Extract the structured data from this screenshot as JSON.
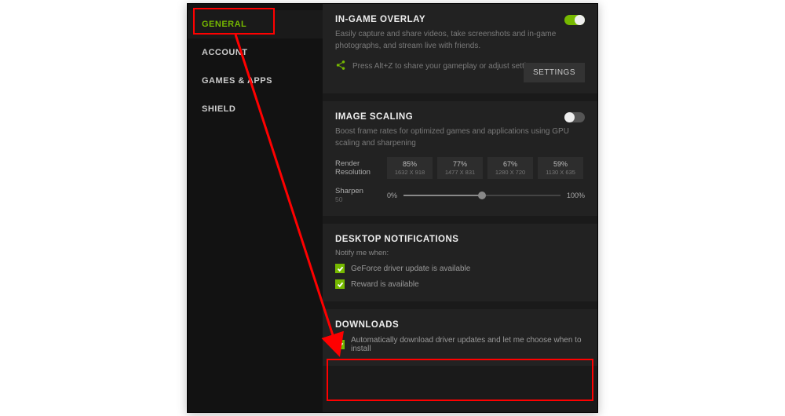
{
  "sidebar": {
    "items": [
      {
        "label": "GENERAL",
        "active": true
      },
      {
        "label": "ACCOUNT",
        "active": false
      },
      {
        "label": "GAMES & APPS",
        "active": false
      },
      {
        "label": "SHIELD",
        "active": false
      }
    ]
  },
  "overlay": {
    "title": "IN-GAME OVERLAY",
    "desc": "Easily capture and share videos, take screenshots and in-game photographs, and stream live with friends.",
    "tip": "Press Alt+Z to share your gameplay or adjust settings.",
    "settings_label": "SETTINGS",
    "toggle_on": true
  },
  "scaling": {
    "title": "IMAGE SCALING",
    "desc": "Boost frame rates for optimized games and applications using GPU scaling and sharpening",
    "render_label": "Render Resolution",
    "presets": [
      {
        "pct": "85%",
        "dim": "1632 X 918"
      },
      {
        "pct": "77%",
        "dim": "1477 X 831"
      },
      {
        "pct": "67%",
        "dim": "1280 X 720"
      },
      {
        "pct": "59%",
        "dim": "1130 X 635"
      }
    ],
    "sharpen_label": "Sharpen",
    "sharpen_value": "50",
    "slider_min": "0%",
    "slider_max": "100%",
    "toggle_on": false
  },
  "notifications": {
    "title": "DESKTOP NOTIFICATIONS",
    "subhead": "Notify me when:",
    "items": [
      {
        "label": "GeForce driver update is available",
        "checked": true
      },
      {
        "label": "Reward is available",
        "checked": true
      }
    ]
  },
  "downloads": {
    "title": "DOWNLOADS",
    "items": [
      {
        "label": "Automatically download driver updates and let me choose when to install",
        "checked": true
      }
    ]
  }
}
